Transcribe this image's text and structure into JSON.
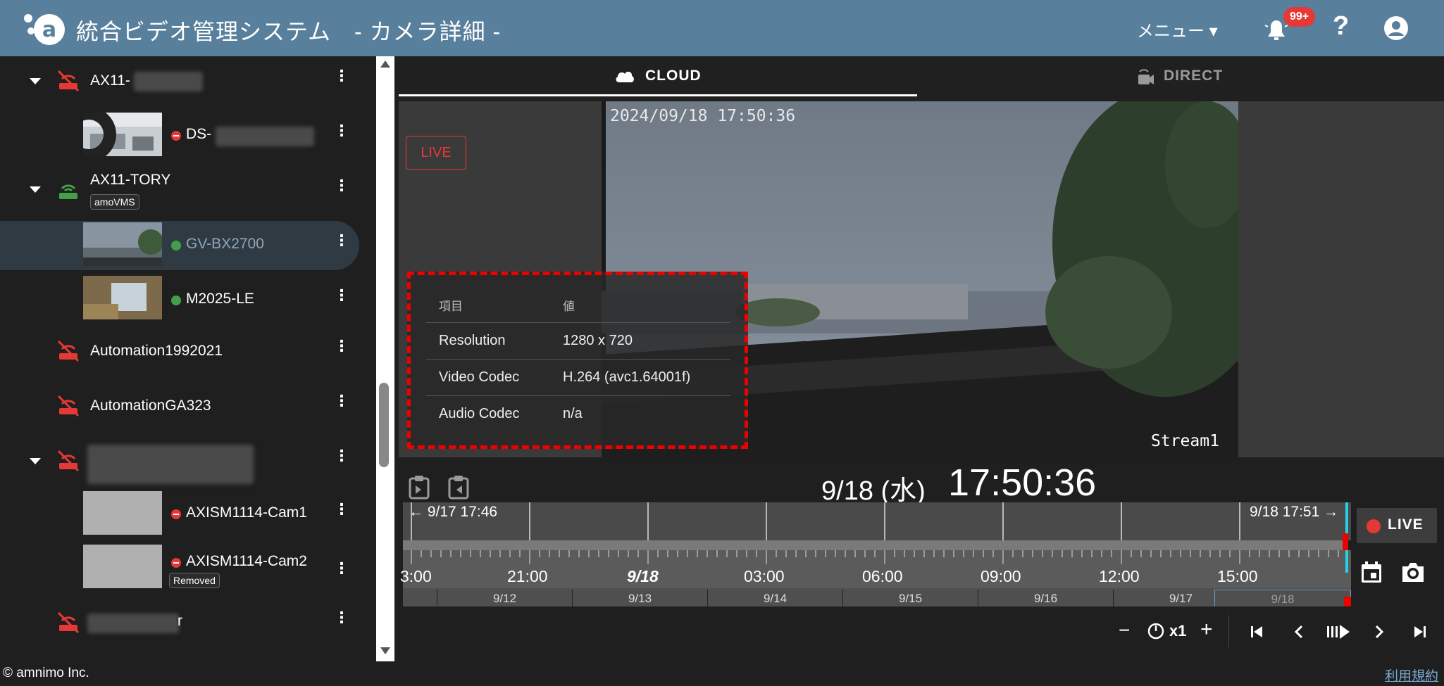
{
  "header": {
    "title": "統合ビデオ管理システム　- カメラ詳細 -",
    "menu_label": "メニュー ▾",
    "notification_badge": "99+",
    "help_label": "?"
  },
  "sidebar": {
    "items": [
      {
        "label": "AX11-",
        "type": "gateway",
        "status": "offline"
      },
      {
        "label": "DS-",
        "type": "camera",
        "status": "offline"
      },
      {
        "label": "AX11-TORY",
        "type": "gateway",
        "status": "online",
        "tag": "amoVMS"
      },
      {
        "label": "GV-BX2700",
        "type": "camera",
        "status": "online",
        "selected": true
      },
      {
        "label": "M2025-LE",
        "type": "camera",
        "status": "online"
      },
      {
        "label": "Automation1992021",
        "type": "gateway",
        "status": "offline"
      },
      {
        "label": "AutomationGA323",
        "type": "gateway",
        "status": "offline"
      },
      {
        "label": "",
        "type": "gateway",
        "status": "offline"
      },
      {
        "label": "AXISM1114-Cam1",
        "type": "camera",
        "status": "offline"
      },
      {
        "label": "AXISM1114-Cam2",
        "type": "camera",
        "status": "offline",
        "tag": "Removed"
      },
      {
        "label": "r",
        "type": "gateway",
        "status": "offline"
      }
    ]
  },
  "tabs": {
    "cloud": "CLOUD",
    "direct": "DIRECT"
  },
  "player": {
    "live_label": "LIVE",
    "overlay_timestamp": "2024/09/18  17:50:36",
    "stream_label": "Stream1"
  },
  "info_table": {
    "col1": "項目",
    "col2": "値",
    "rows": [
      {
        "key": "Resolution",
        "value": "1280 x 720"
      },
      {
        "key": "Video Codec",
        "value": "H.264 (avc1.64001f)"
      },
      {
        "key": "Audio Codec",
        "value": "n/a"
      }
    ]
  },
  "clock": {
    "date": "9/18 (水)",
    "time": "17:50:36"
  },
  "timeline": {
    "start_label": "← 9/17 17:46",
    "end_label": "9/18 17:51 →",
    "hours": [
      "3:00",
      "21:00",
      "9/18",
      "03:00",
      "06:00",
      "09:00",
      "12:00",
      "15:00"
    ],
    "days": [
      "9/12",
      "9/13",
      "9/14",
      "9/15",
      "9/16",
      "9/17",
      "9/18"
    ],
    "live_button": "LIVE"
  },
  "playback": {
    "minus": "−",
    "speed": "x1",
    "plus": "+"
  },
  "footer": {
    "copyright": "© amnimo Inc.",
    "terms": "利用規約"
  },
  "colors": {
    "header_bg": "#58809d",
    "offline": "#e53935",
    "online": "#43a047",
    "accent_cyan": "#26d0e6"
  }
}
